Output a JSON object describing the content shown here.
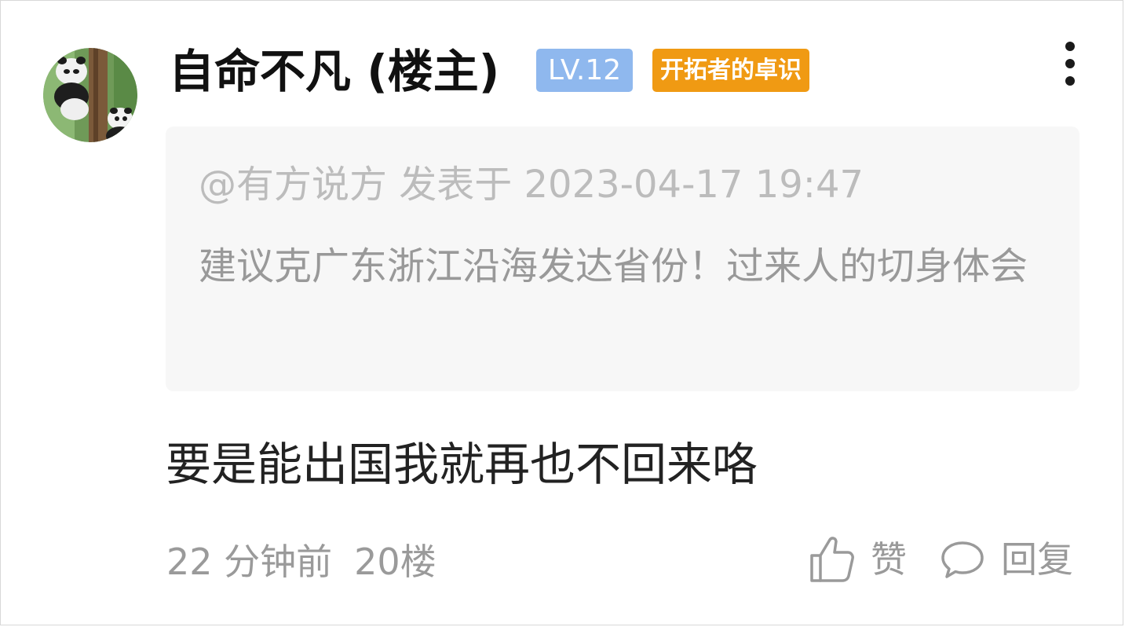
{
  "post": {
    "username": "自命不凡 (楼主)",
    "level_badge": "LV.12",
    "title_badge": "开拓者的卓识",
    "quote": {
      "meta": "@有方说方 发表于 2023-04-17 19:47",
      "text": "建议克广东浙江沿海发达省份！过来人的切身体会"
    },
    "body": "要是能出国我就再也不回来咯",
    "time_ago": "22 分钟前",
    "floor": "20楼"
  },
  "actions": {
    "like_label": "赞",
    "reply_label": "回复"
  },
  "icons": {
    "more": "more-vertical-icon",
    "like": "thumbs-up-icon",
    "reply": "comment-bubble-icon"
  },
  "colors": {
    "level_badge_bg": "#8fb8ee",
    "title_badge_bg": "#f09a13",
    "quote_bg": "#f7f7f7",
    "meta_text": "#9a9a9a"
  }
}
